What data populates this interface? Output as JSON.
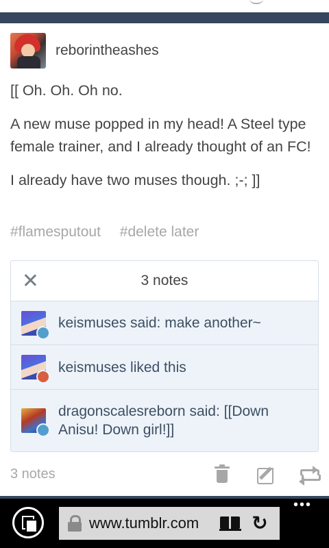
{
  "post": {
    "username": "reborintheashes",
    "body": [
      "[[ Oh. Oh. Oh no.",
      "A new muse popped in my head! A Steel type female trainer, and I already thought of an FC!",
      "I already have two muses though. ;-; ]]"
    ],
    "tags": [
      "#flamesputout",
      "#delete later"
    ]
  },
  "notes_panel": {
    "title": "3 notes",
    "notes": [
      {
        "text": "keismuses said: make another~",
        "badge": "reply"
      },
      {
        "text": "keismuses liked this",
        "badge": "like"
      },
      {
        "text": "dragonscalesreborn said: [[Down Anisu! Down girl!]]",
        "badge": "reply"
      }
    ]
  },
  "footer": {
    "notes_count": "3 notes"
  },
  "browser": {
    "url": "www.tumblr.com",
    "more_label": "•••"
  },
  "colors": {
    "tumblr_navy": "#36465d",
    "note_bg": "#edf3f9",
    "reply_badge": "#529ecc",
    "like_badge": "#d95e40"
  }
}
